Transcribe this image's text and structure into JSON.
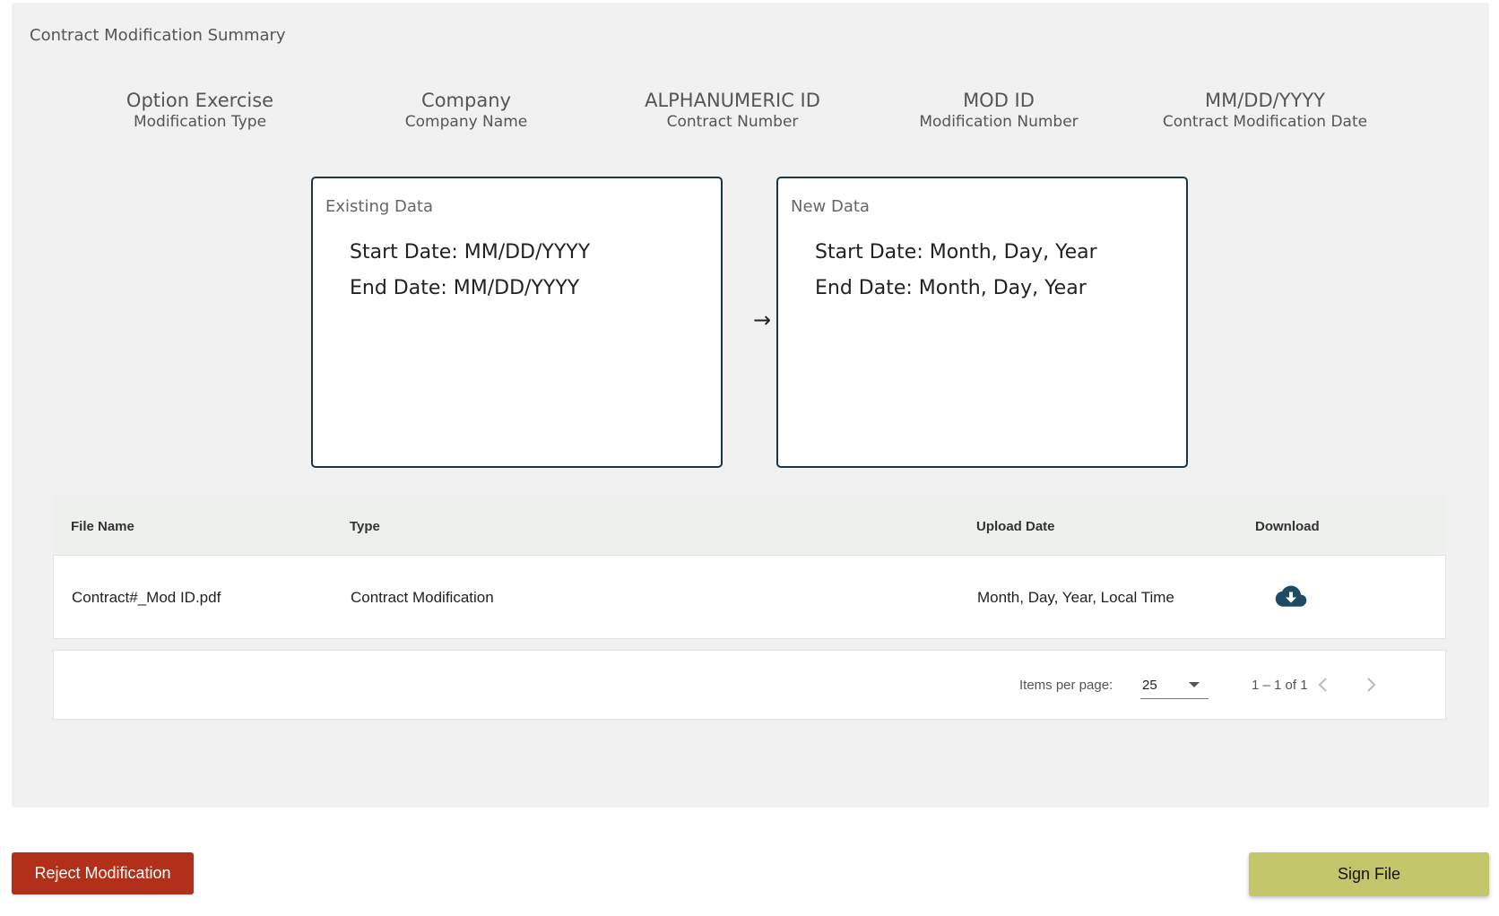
{
  "panel": {
    "title": "Contract Modification Summary"
  },
  "summary": [
    {
      "value": "Option Exercise",
      "label": "Modification Type"
    },
    {
      "value": "Company",
      "label": "Company Name"
    },
    {
      "value": "ALPHANUMERIC ID",
      "label": "Contract Number"
    },
    {
      "value": "MOD ID",
      "label": "Modification Number"
    },
    {
      "value": "MM/DD/YYYY",
      "label": "Contract Modification Date"
    }
  ],
  "existing": {
    "title": "Existing Data",
    "start": "Start Date: MM/DD/YYYY",
    "end": "End Date: MM/DD/YYYY"
  },
  "new_data": {
    "title": "New Data",
    "start": "Start Date: Month, Day, Year",
    "end": "End Date: Month, Day, Year"
  },
  "arrow_glyph": "→",
  "table": {
    "headers": {
      "file_name": "File Name",
      "type": "Type",
      "upload_date": "Upload Date",
      "download": "Download"
    },
    "rows": [
      {
        "file_name": "Contract#_Mod ID.pdf",
        "type": "Contract Modification",
        "upload_date": "Month, Day, Year, Local Time",
        "download_icon": "cloud-download-icon"
      }
    ]
  },
  "paginator": {
    "items_per_page_label": "Items per page:",
    "items_per_page_value": "25",
    "range_label": "1 – 1 of 1"
  },
  "actions": {
    "reject_label": "Reject Modification",
    "sign_label": "Sign File"
  },
  "colors": {
    "reject": "#b22f1a",
    "sign": "#c4c66c",
    "box_border": "#1b3448",
    "download_icon": "#1e4a63"
  }
}
